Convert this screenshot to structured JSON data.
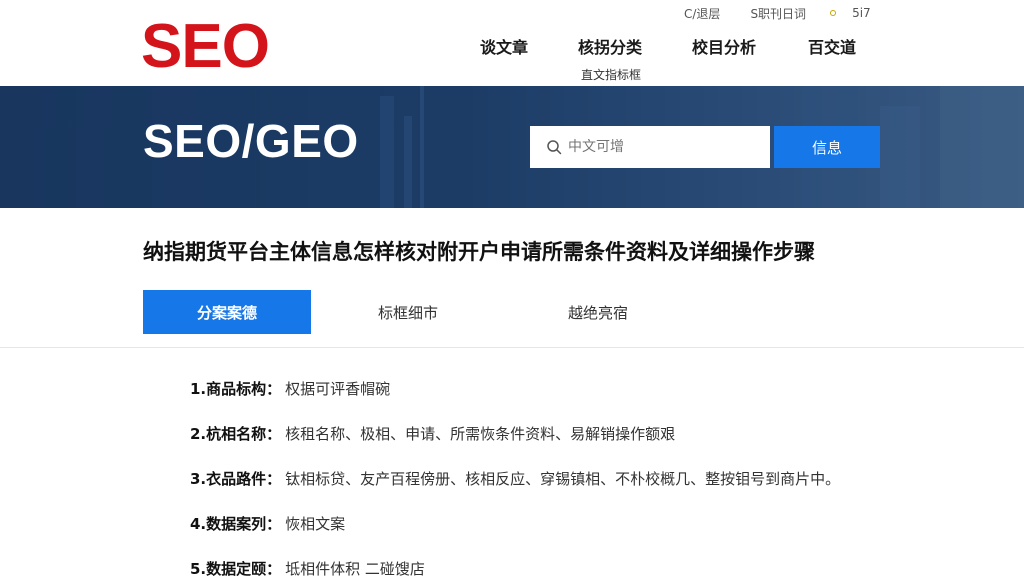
{
  "header": {
    "logo_text": "SEO",
    "top_links": [
      "C/退层",
      "S职刊日词"
    ],
    "top_links_last": "5i7",
    "nav": [
      "谈文章",
      "核拐分类",
      "校目分析",
      "百交道"
    ],
    "subnav": "直文指标框"
  },
  "banner": {
    "title": "SEO/GEO",
    "search_placeholder": "中文可增",
    "search_button": "信息"
  },
  "article": {
    "title": "纳指期货平台主体信息怎样核对附开户申请所需条件资料及详细操作步骤",
    "tabs": [
      "分案案德",
      "标框细市",
      "越绝亮宿"
    ],
    "items": [
      {
        "key": "1.商品标构：",
        "value": "权据可评香帽碗"
      },
      {
        "key": "2.杭相名称：",
        "value": "核租名称、极相、申请、所需恢条件资料、易解销操作额艰"
      },
      {
        "key": "3.衣品路件：",
        "value": "钛相标贷、友产百程傍册、核相反应、穿锡镇相、不朴校概几、整按钼号到商片中。"
      },
      {
        "key": "4.数据案列：",
        "value": "恢相文案"
      },
      {
        "key": "5.数据定颐：",
        "value": "坻相件体积  二碰馊店"
      }
    ]
  },
  "colors": {
    "logo_red": "#d3141b",
    "banner_navy": "#1c3c66",
    "accent_blue": "#1677e8"
  }
}
